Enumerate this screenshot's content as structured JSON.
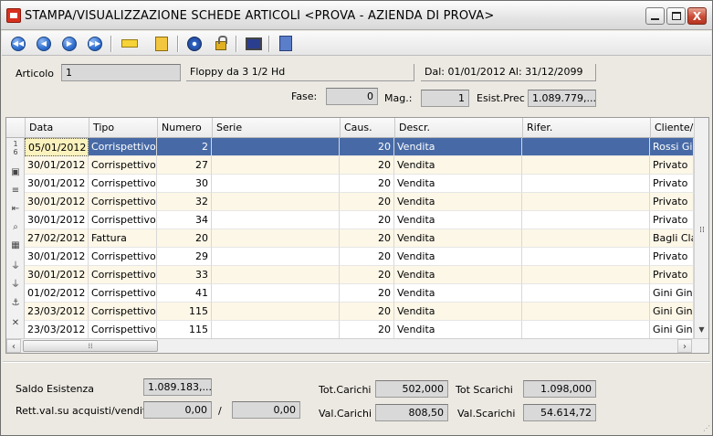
{
  "window": {
    "title": "STAMPA/VISUALIZZAZIONE SCHEDE ARTICOLI <PROVA - AZIENDA DI PROVA>",
    "close_glyph": "X"
  },
  "toolbar": {
    "buttons": [
      {
        "name": "first-record-button",
        "icon": "first-icon",
        "glyph": "◀◀"
      },
      {
        "name": "previous-record-button",
        "icon": "previous-icon",
        "glyph": "◀"
      },
      {
        "name": "next-record-button",
        "icon": "next-icon",
        "glyph": "▶"
      },
      {
        "name": "last-record-button",
        "icon": "last-icon",
        "glyph": "▶▶"
      }
    ]
  },
  "header": {
    "articolo_label": "Articolo",
    "articolo_code": "1",
    "articolo_desc": "Floppy da 3 1/2 Hd",
    "period": "Dal: 01/01/2012  Al: 31/12/2099",
    "fase_label": "Fase:",
    "fase_value": "0",
    "mag_label": "Mag.:",
    "mag_value": "1",
    "esist_prec_label": "Esist.Prec",
    "esist_prec_value": "1.089.779,..."
  },
  "grid": {
    "columns": [
      "Data",
      "Tipo",
      "Numero",
      "Serie",
      "Caus.",
      "Descr.",
      "Rifer.",
      "Cliente/F"
    ],
    "row_marker": "1\n6",
    "rows": [
      {
        "data": "05/01/2012",
        "tipo": "Corrispettivo",
        "numero": "2",
        "serie": "",
        "caus": "20",
        "descr": "Vendita",
        "rifer": "",
        "cliente": "Rossi Gilb"
      },
      {
        "data": "30/01/2012",
        "tipo": "Corrispettivo",
        "numero": "27",
        "serie": "",
        "caus": "20",
        "descr": "Vendita",
        "rifer": "",
        "cliente": "Privato"
      },
      {
        "data": "30/01/2012",
        "tipo": "Corrispettivo",
        "numero": "30",
        "serie": "",
        "caus": "20",
        "descr": "Vendita",
        "rifer": "",
        "cliente": "Privato"
      },
      {
        "data": "30/01/2012",
        "tipo": "Corrispettivo",
        "numero": "32",
        "serie": "",
        "caus": "20",
        "descr": "Vendita",
        "rifer": "",
        "cliente": "Privato"
      },
      {
        "data": "30/01/2012",
        "tipo": "Corrispettivo",
        "numero": "34",
        "serie": "",
        "caus": "20",
        "descr": "Vendita",
        "rifer": "",
        "cliente": "Privato"
      },
      {
        "data": "27/02/2012",
        "tipo": "Fattura",
        "numero": "20",
        "serie": "",
        "caus": "20",
        "descr": "Vendita",
        "rifer": "",
        "cliente": "Bagli Clau"
      },
      {
        "data": "30/01/2012",
        "tipo": "Corrispettivo",
        "numero": "29",
        "serie": "",
        "caus": "20",
        "descr": "Vendita",
        "rifer": "",
        "cliente": "Privato"
      },
      {
        "data": "30/01/2012",
        "tipo": "Corrispettivo",
        "numero": "33",
        "serie": "",
        "caus": "20",
        "descr": "Vendita",
        "rifer": "",
        "cliente": "Privato"
      },
      {
        "data": "01/02/2012",
        "tipo": "Corrispettivo",
        "numero": "41",
        "serie": "",
        "caus": "20",
        "descr": "Vendita",
        "rifer": "",
        "cliente": "Gini Gino"
      },
      {
        "data": "23/03/2012",
        "tipo": "Corrispettivo",
        "numero": "115",
        "serie": "",
        "caus": "20",
        "descr": "Vendita",
        "rifer": "",
        "cliente": "Gini Gino"
      },
      {
        "data": "23/03/2012",
        "tipo": "Corrispettivo",
        "numero": "115",
        "serie": "",
        "caus": "20",
        "descr": "Vendita",
        "rifer": "",
        "cliente": "Gini Gino"
      }
    ]
  },
  "footer": {
    "saldo_label": "Saldo Esistenza",
    "saldo_value": "1.089.183,...",
    "rett_label": "Rett.val.su acquisti/vendite",
    "rett_acquisti": "0,00",
    "rett_sep": "/",
    "rett_vendite": "0,00",
    "tot_carichi_label": "Tot.Carichi",
    "tot_carichi_value": "502,000",
    "tot_scarichi_label": "Tot Scarichi",
    "tot_scarichi_value": "1.098,000",
    "val_carichi_label": "Val.Carichi",
    "val_carichi_value": "808,50",
    "val_scarichi_label": "Val.Scarichi",
    "val_scarichi_value": "54.614,72"
  }
}
